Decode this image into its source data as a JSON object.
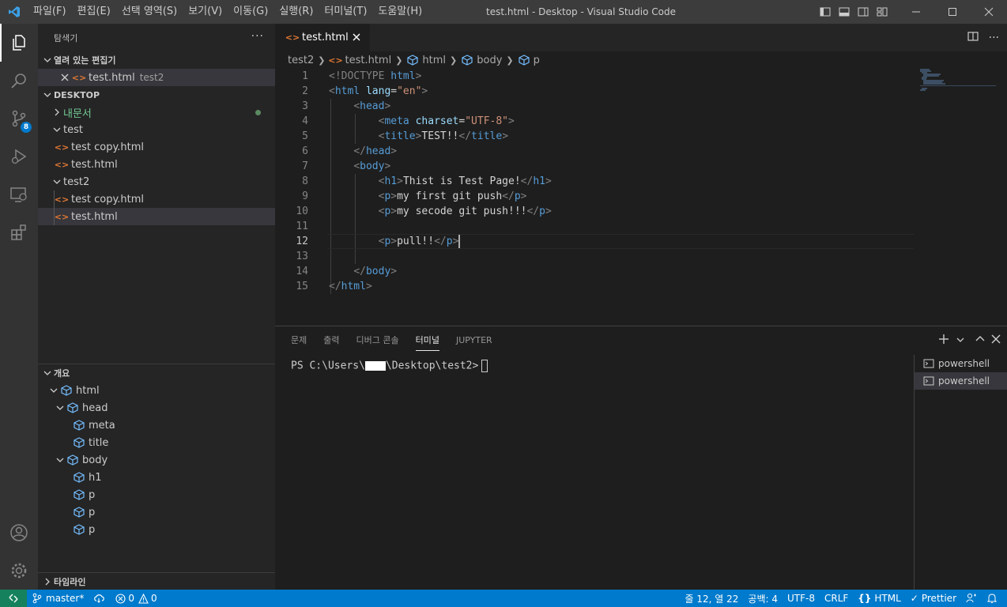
{
  "titlebar": {
    "window_title": "test.html - Desktop - Visual Studio Code",
    "menu": [
      "파일(F)",
      "편집(E)",
      "선택 영역(S)",
      "보기(V)",
      "이동(G)",
      "실행(R)",
      "터미널(T)",
      "도움말(H)"
    ]
  },
  "activitybar": {
    "items": [
      "files-icon",
      "search-icon",
      "source-control-icon",
      "run-debug-icon",
      "remote-explorer-icon",
      "extensions-icon"
    ],
    "source_control_badge": "8"
  },
  "sidebar": {
    "title": "탐색기",
    "more": "···",
    "open_editors": {
      "title": "열려 있는 편집기",
      "items": [
        {
          "name": "test.html",
          "desc": "test2"
        }
      ]
    },
    "folder": {
      "title": "DESKTOP",
      "tree": [
        {
          "label": "내문서",
          "kind": "folder-collapsed",
          "modified": true
        },
        {
          "label": "test",
          "kind": "folder-open"
        },
        {
          "label": "test copy.html",
          "kind": "file"
        },
        {
          "label": "test.html",
          "kind": "file"
        },
        {
          "label": "test2",
          "kind": "folder-open"
        },
        {
          "label": "test copy.html",
          "kind": "file"
        },
        {
          "label": "test.html",
          "kind": "file",
          "selected": true
        }
      ]
    },
    "outline": {
      "title": "개요",
      "items": [
        "html",
        "head",
        "meta",
        "title",
        "body",
        "h1",
        "p",
        "p",
        "p"
      ]
    },
    "timeline": {
      "title": "타임라인"
    }
  },
  "editor": {
    "tab_label": "test.html",
    "breadcrumb": [
      "test2",
      "test.html",
      "html",
      "body",
      "p"
    ],
    "line_numbers": [
      "1",
      "2",
      "3",
      "4",
      "5",
      "6",
      "7",
      "8",
      "9",
      "10",
      "11",
      "12",
      "13",
      "14",
      "15"
    ],
    "current_line": "12",
    "code": {
      "l1_doctype": "<!DOCTYPE",
      "l1_html": "html",
      "l1_end": ">",
      "l2_tag": "html",
      "l2_attr": "lang",
      "l2_val": "\"en\"",
      "head": "head",
      "meta": "meta",
      "charset": "charset",
      "charset_val": "\"UTF-8\"",
      "title": "title",
      "title_text": "TEST!!",
      "body": "body",
      "h1": "h1",
      "h1_text": "Thist is Test Page!",
      "p": "p",
      "p1_text": "my first git push",
      "p2_text": "my secode git push!!!",
      "p3_text": "pull!!"
    }
  },
  "panel": {
    "tabs": [
      "문제",
      "출력",
      "디버그 콘솔",
      "터미널",
      "JUPYTER"
    ],
    "active_tab": "터미널",
    "terminal_prefix": "PS C:\\Users\\",
    "terminal_suffix": "\\Desktop\\test2>",
    "terminals": [
      "powershell",
      "powershell"
    ]
  },
  "statusbar": {
    "branch": "master*",
    "errors": "0",
    "warnings": "0",
    "position": "줄 12, 열 22",
    "spaces": "공백: 4",
    "encoding": "UTF-8",
    "eol": "CRLF",
    "language": "HTML",
    "formatter": "Prettier"
  },
  "colors": {
    "accent": "#007acc",
    "tag": "#569cd6",
    "attribute": "#9cdcfe",
    "string": "#ce9178",
    "html_file_icon": "#e37933",
    "outline_icon": "#75beff",
    "modified_folder": "#73c991"
  }
}
